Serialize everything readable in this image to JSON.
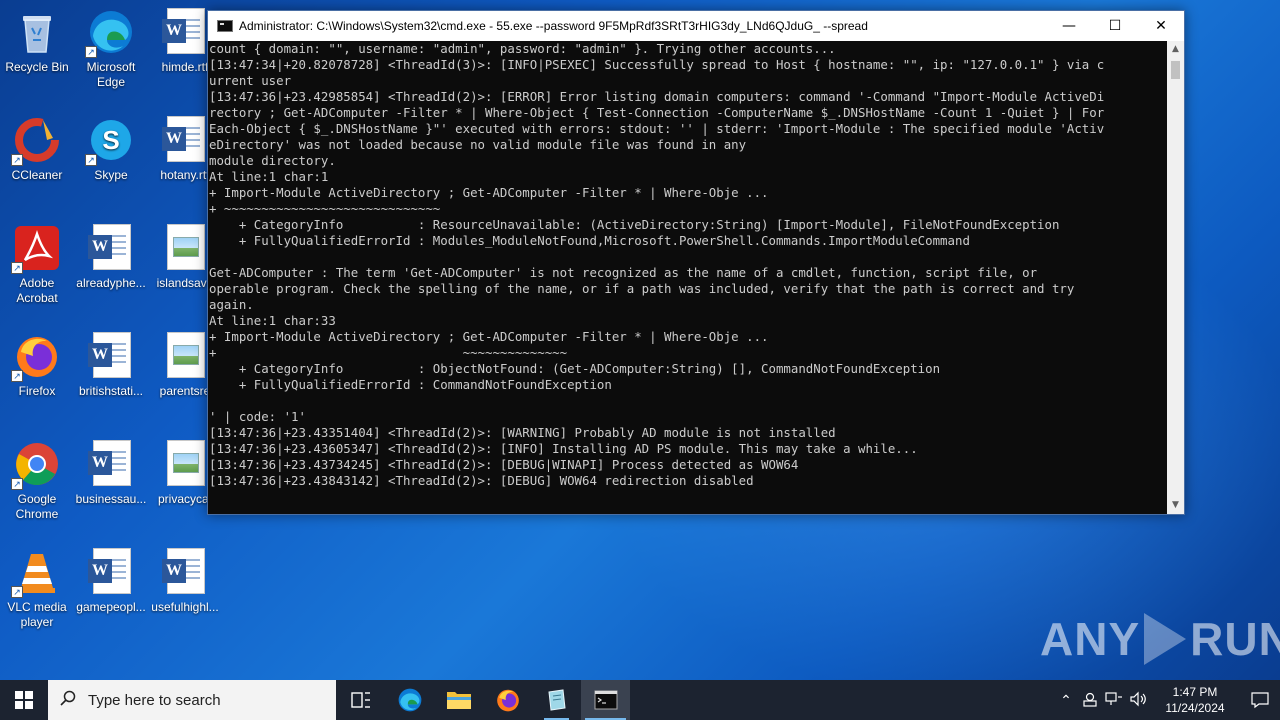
{
  "desktop": {
    "icons": [
      {
        "id": "recycle-bin",
        "label": "Recycle Bin"
      },
      {
        "id": "microsoft-edge",
        "label": "Microsoft Edge"
      },
      {
        "id": "himde",
        "label": "himde.rtf"
      },
      {
        "id": "ccleaner",
        "label": "CCleaner"
      },
      {
        "id": "skype",
        "label": "Skype"
      },
      {
        "id": "hotany",
        "label": "hotany.rtf"
      },
      {
        "id": "adobe-acrobat",
        "label": "Adobe Acrobat"
      },
      {
        "id": "alreadyphe",
        "label": "alreadyphe..."
      },
      {
        "id": "islandsave",
        "label": "islandsave"
      },
      {
        "id": "firefox",
        "label": "Firefox"
      },
      {
        "id": "britishstati",
        "label": "britishstati..."
      },
      {
        "id": "parentsre",
        "label": "parentsre"
      },
      {
        "id": "google-chrome",
        "label": "Google Chrome"
      },
      {
        "id": "businessau",
        "label": "businessau..."
      },
      {
        "id": "privacycat",
        "label": "privacycat"
      },
      {
        "id": "vlc",
        "label": "VLC media player"
      },
      {
        "id": "gamepeopl",
        "label": "gamepeopl..."
      },
      {
        "id": "usefulhighl",
        "label": "usefulhighl..."
      }
    ]
  },
  "cmd_window": {
    "title": "Administrator: C:\\Windows\\System32\\cmd.exe - 55.exe  --password 9F5MpRdf3SRtT3rHIG3dy_LNd6QJduG_ --spread",
    "minimize": "—",
    "maximize": "☐",
    "close": "✕",
    "console_lines": [
      "count { domain: \"\", username: \"admin\", password: \"admin\" }. Trying other accounts...",
      "[13:47:34|+20.82078728] <ThreadId(3)>: [INFO|PSEXEC] Successfully spread to Host { hostname: \"\", ip: \"127.0.0.1\" } via c",
      "urrent user",
      "[13:47:36|+23.42985854] <ThreadId(2)>: [ERROR] Error listing domain computers: command '-Command \"Import-Module ActiveDi",
      "rectory ; Get-ADComputer -Filter * | Where-Object { Test-Connection -ComputerName $_.DNSHostName -Count 1 -Quiet } | For",
      "Each-Object { $_.DNSHostName }\"' executed with errors: stdout: '' | stderr: 'Import-Module : The specified module 'Activ",
      "eDirectory' was not loaded because no valid module file was found in any",
      "module directory.",
      "At line:1 char:1",
      "+ Import-Module ActiveDirectory ; Get-ADComputer -Filter * | Where-Obje ...",
      "+ ~~~~~~~~~~~~~~~~~~~~~~~~~~~~~",
      "    + CategoryInfo          : ResourceUnavailable: (ActiveDirectory:String) [Import-Module], FileNotFoundException",
      "    + FullyQualifiedErrorId : Modules_ModuleNotFound,Microsoft.PowerShell.Commands.ImportModuleCommand",
      "",
      "Get-ADComputer : The term 'Get-ADComputer' is not recognized as the name of a cmdlet, function, script file, or",
      "operable program. Check the spelling of the name, or if a path was included, verify that the path is correct and try",
      "again.",
      "At line:1 char:33",
      "+ Import-Module ActiveDirectory ; Get-ADComputer -Filter * | Where-Obje ...",
      "+                                 ~~~~~~~~~~~~~~",
      "    + CategoryInfo          : ObjectNotFound: (Get-ADComputer:String) [], CommandNotFoundException",
      "    + FullyQualifiedErrorId : CommandNotFoundException",
      "",
      "' | code: '1'",
      "[13:47:36|+23.43351404] <ThreadId(2)>: [WARNING] Probably AD module is not installed",
      "[13:47:36|+23.43605347] <ThreadId(2)>: [INFO] Installing AD PS module. This may take a while...",
      "[13:47:36|+23.43734245] <ThreadId(2)>: [DEBUG|WINAPI] Process detected as WOW64",
      "[13:47:36|+23.43843142] <ThreadId(2)>: [DEBUG] WOW64 redirection disabled"
    ]
  },
  "watermark": {
    "left": "ANY",
    "right": "RUN"
  },
  "taskbar": {
    "search_placeholder": "Type here to search",
    "time": "1:47 PM",
    "date": "11/24/2024"
  },
  "colors": {
    "console_bg": "#0c0c0c",
    "console_text": "#cccccc",
    "taskbar_bg": "#1c2330",
    "accent": "#76b9ed"
  }
}
